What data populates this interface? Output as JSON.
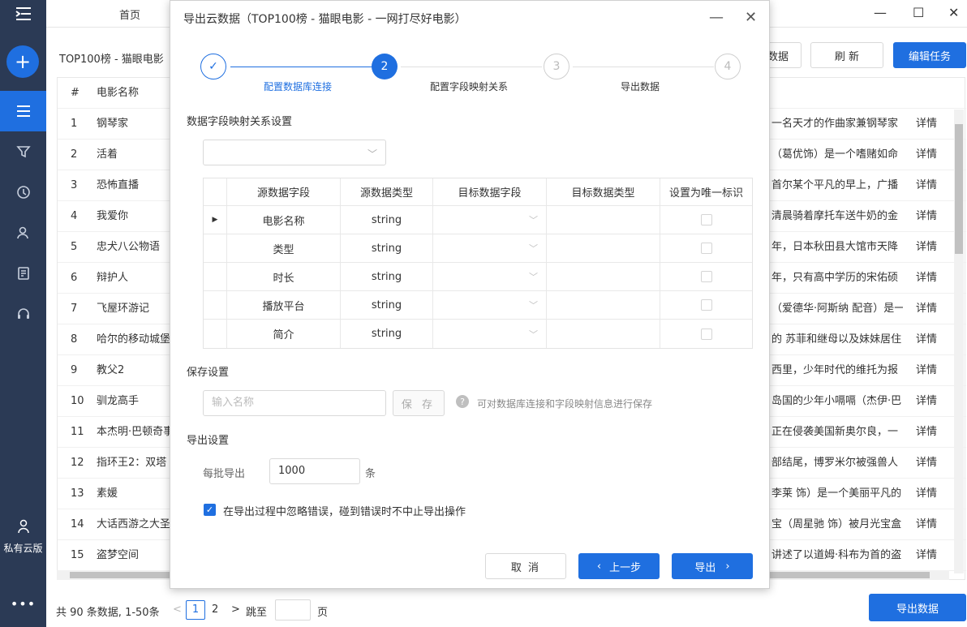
{
  "topbar": {
    "home_tab": "首页"
  },
  "subbar": {
    "breadcrumb": "TOP100榜 - 猫眼电影",
    "export_btn_partial": "数据",
    "refresh_btn": "刷 新",
    "edit_btn": "编辑任务"
  },
  "bgtable": {
    "headers": {
      "num": "#",
      "name": "电影名称"
    },
    "detail_label": "详情",
    "rows": [
      {
        "num": "1",
        "name": "钢琴家",
        "desc": "一名天才的作曲家兼钢琴家"
      },
      {
        "num": "2",
        "name": "活着",
        "desc": "（葛优饰）是一个嗜赌如命"
      },
      {
        "num": "3",
        "name": "恐怖直播",
        "desc": "首尔某个平凡的早上，广播"
      },
      {
        "num": "4",
        "name": "我爱你",
        "desc": "清晨骑着摩托车送牛奶的金"
      },
      {
        "num": "5",
        "name": "忠犬八公物语",
        "desc": "年，日本秋田县大馆市天降"
      },
      {
        "num": "6",
        "name": "辩护人",
        "desc": "年，只有高中学历的宋佑硕"
      },
      {
        "num": "7",
        "name": "飞屋环游记",
        "desc": "（爱德华·阿斯纳 配音）是一"
      },
      {
        "num": "8",
        "name": "哈尔的移动城堡",
        "desc": "的 苏菲和继母以及妹妹居住"
      },
      {
        "num": "9",
        "name": "教父2",
        "desc": "西里，少年时代的维托为报"
      },
      {
        "num": "10",
        "name": "驯龙高手",
        "desc": "岛国的少年小嗝嗝（杰伊·巴"
      },
      {
        "num": "11",
        "name": "本杰明·巴顿奇事",
        "desc": "正在侵袭美国新奥尔良，一"
      },
      {
        "num": "12",
        "name": "指环王2：双塔",
        "desc": "部结尾，博罗米尔被强兽人"
      },
      {
        "num": "13",
        "name": "素媛",
        "desc": "李莱 饰）是一个美丽平凡的"
      },
      {
        "num": "14",
        "name": "大话西游之大圣娶亲",
        "desc": "宝（周星驰 饰）被月光宝盒"
      },
      {
        "num": "15",
        "name": "盗梦空间",
        "desc": "讲述了以道姆·科布为首的盗"
      }
    ]
  },
  "footer": {
    "summary": "共 90 条数据, 1-50条",
    "prev": "<",
    "page1": "1",
    "page2": "2",
    "next": ">",
    "jump": "跳至",
    "page_unit": "页",
    "export_btn": "导出数据"
  },
  "sidebar": {
    "user_label": "私有云版",
    "more": "•••"
  },
  "modal": {
    "title": "导出云数据（TOP100榜 - 猫眼电影 - 一网打尽好电影）",
    "steps": [
      {
        "num": "✓",
        "label": "配置数据库连接"
      },
      {
        "num": "2",
        "label": "配置字段映射关系"
      },
      {
        "num": "3",
        "label": "导出数据"
      },
      {
        "num": "4",
        "label": ""
      }
    ],
    "mapping_title": "数据字段映射关系设置",
    "map_headers": [
      "源数据字段",
      "源数据类型",
      "目标数据字段",
      "目标数据类型",
      "设置为唯一标识"
    ],
    "map_rows": [
      {
        "field": "电影名称",
        "type": "string"
      },
      {
        "field": "类型",
        "type": "string"
      },
      {
        "field": "时长",
        "type": "string"
      },
      {
        "field": "播放平台",
        "type": "string"
      },
      {
        "field": "简介",
        "type": "string"
      }
    ],
    "save_title": "保存设置",
    "name_placeholder": "输入名称",
    "save_btn": "保 存",
    "save_help": "可对数据库连接和字段映射信息进行保存",
    "export_title": "导出设置",
    "batch_label": "每批导出",
    "batch_value": "1000",
    "batch_unit": "条",
    "ignore_errors": "在导出过程中忽略错误，碰到错误时不中止导出操作",
    "cancel_btn": "取 消",
    "prev_btn": "上一步",
    "export_btn": "导出"
  },
  "colors": {
    "primary": "#1f6fe0",
    "sidebar": "#2b3a55"
  }
}
